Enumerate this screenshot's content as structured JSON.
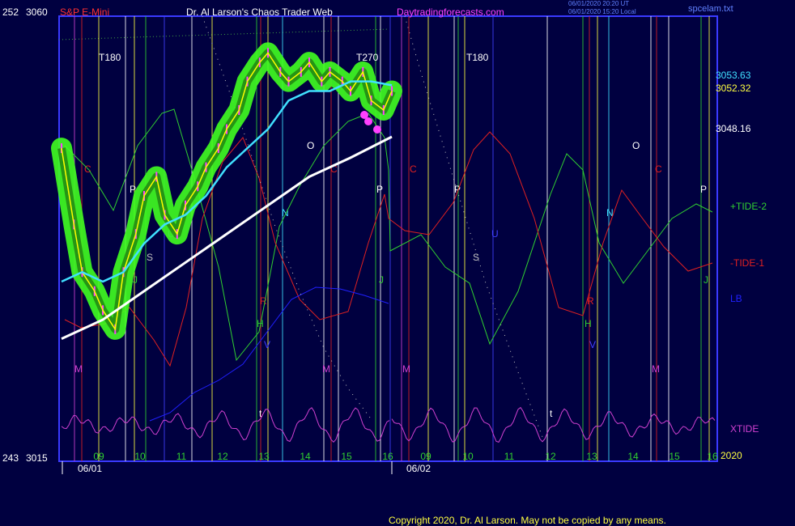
{
  "header": {
    "symbol": "S&P E-Mini",
    "left_top_index": "252",
    "left_top_price": "3060",
    "left_bottom_index": "243",
    "left_bottom_price": "3015",
    "title": "Dr. Al Larson's Chaos Trader Web",
    "site": "Daytradingforecasts.com",
    "timestamp_utc": "06/01/2020 20:20 UT",
    "timestamp_local": "06/01/2020 15:20 Local",
    "file": "spcelam.txt"
  },
  "footer": {
    "copyright": "Copyright 2020, Dr. Al Larson. May not be copied by any means.",
    "year": "2020"
  },
  "colors": {
    "background": "#000040",
    "frame": "#3a3aff",
    "price": "#ffff00",
    "fast_ma": "#40e0ff",
    "slow_ma": "#ffffff",
    "tide1": "#e02020",
    "tide2": "#30d030",
    "lb": "#2020ff",
    "xtide": "#d040d0",
    "glow": "#40ff20"
  },
  "chart_data": {
    "type": "line",
    "title": "S&P E-Mini",
    "ylim": [
      3015,
      3060
    ],
    "date_labels": [
      "06/01",
      "06/02"
    ],
    "hour_ticks": [
      "09",
      "10",
      "11",
      "12",
      "13",
      "14",
      "15",
      "16",
      "09",
      "10",
      "11",
      "12",
      "13",
      "14",
      "15",
      "16"
    ],
    "price_levels": [
      "3053.63",
      "3052.32",
      "3048.16"
    ],
    "series_labels": [
      "+TIDE-2",
      "-TIDE-1",
      "LB",
      "XTIDE"
    ],
    "annotations": [
      "T180",
      "T270",
      "T180",
      "C",
      "C",
      "C",
      "C",
      "P",
      "P",
      "P",
      "P",
      "O",
      "O",
      "N",
      "N",
      "U",
      "U",
      "S",
      "S",
      "J",
      "J",
      "J",
      "R",
      "R",
      "H",
      "H",
      "M",
      "M",
      "M",
      "M",
      "V",
      "V",
      "t",
      "t"
    ],
    "price": {
      "x": [
        0,
        0.3,
        0.5,
        0.8,
        1.0,
        1.3,
        1.5,
        1.8,
        2.0,
        2.3,
        2.5,
        2.8,
        3.0,
        3.3,
        3.5,
        3.8,
        4.0,
        4.3,
        4.5,
        4.8,
        5.0,
        5.3,
        5.5,
        5.8,
        6.0,
        6.3,
        6.5,
        6.8,
        7.0,
        7.3,
        7.5,
        7.8,
        8.0
      ],
      "values": [
        3047,
        3039,
        3034,
        3032,
        3030,
        3028,
        3034,
        3038,
        3042,
        3044,
        3040,
        3038,
        3041,
        3043,
        3045,
        3047,
        3049,
        3051,
        3054,
        3056,
        3057,
        3055,
        3054,
        3055,
        3056,
        3054,
        3055,
        3054,
        3053,
        3055,
        3052,
        3051,
        3053
      ]
    },
    "fast_ma": {
      "x": [
        0,
        0.5,
        1.0,
        1.5,
        2.0,
        2.5,
        3.0,
        3.5,
        4.0,
        4.5,
        5.0,
        5.5,
        6.0,
        6.5,
        7.0,
        7.5,
        8.0
      ],
      "values": [
        3033,
        3034,
        3033,
        3034,
        3037,
        3039,
        3040,
        3042,
        3045,
        3047,
        3049,
        3052,
        3053,
        3053,
        3054,
        3054,
        3053.6
      ]
    },
    "slow_ma": {
      "x": [
        0,
        1.0,
        2.0,
        3.0,
        4.0,
        5.0,
        6.0,
        7.0,
        8.0
      ],
      "values": [
        3027,
        3029,
        3032,
        3035,
        3038,
        3041,
        3044,
        3046,
        3048.2
      ]
    }
  }
}
